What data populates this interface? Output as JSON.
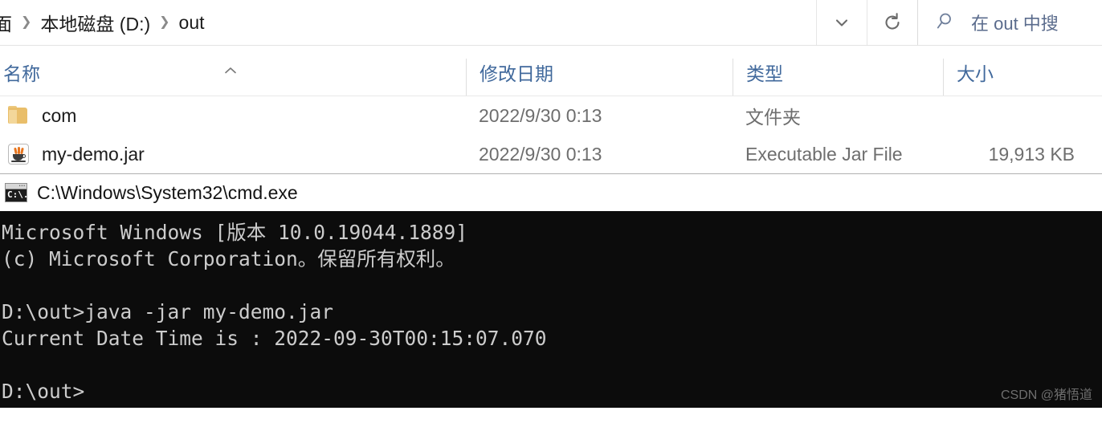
{
  "explorer": {
    "breadcrumb": {
      "items": [
        {
          "label": "面",
          "clipped": true
        },
        {
          "label": "本地磁盘 (D:)",
          "clipped": false
        },
        {
          "label": "out",
          "clipped": false
        }
      ],
      "separator": "❯"
    },
    "address_dropdown_icon": "chevron-down-icon",
    "refresh_icon": "refresh-icon",
    "search": {
      "icon": "search-icon",
      "placeholder": "在 out 中搜"
    },
    "columns": [
      {
        "key": "name",
        "label": "名称",
        "sorted": "asc",
        "sort_caret": "⌃"
      },
      {
        "key": "date",
        "label": "修改日期"
      },
      {
        "key": "type",
        "label": "类型"
      },
      {
        "key": "size",
        "label": "大小"
      }
    ],
    "files": [
      {
        "icon": "folder-icon",
        "name": "com",
        "date": "2022/9/30 0:13",
        "type": "文件夹",
        "size": ""
      },
      {
        "icon": "java-jar-icon",
        "name": "my-demo.jar",
        "date": "2022/9/30 0:13",
        "type": "Executable Jar File",
        "size": "19,913 KB"
      }
    ]
  },
  "cmd": {
    "icon": "cmd-console-icon",
    "icon_glyph": "C:\\.",
    "title": "C:\\Windows\\System32\\cmd.exe",
    "console_lines": [
      "Microsoft Windows [版本 10.0.19044.1889]",
      "(c) Microsoft Corporation。保留所有权利。",
      "",
      "D:\\out>java -jar my-demo.jar",
      "Current Date Time is : 2022-09-30T00:15:07.070",
      "",
      "D:\\out>"
    ],
    "background_color": "#0c0c0c",
    "text_color": "#cccccc"
  },
  "watermark": "CSDN @猪悟道"
}
